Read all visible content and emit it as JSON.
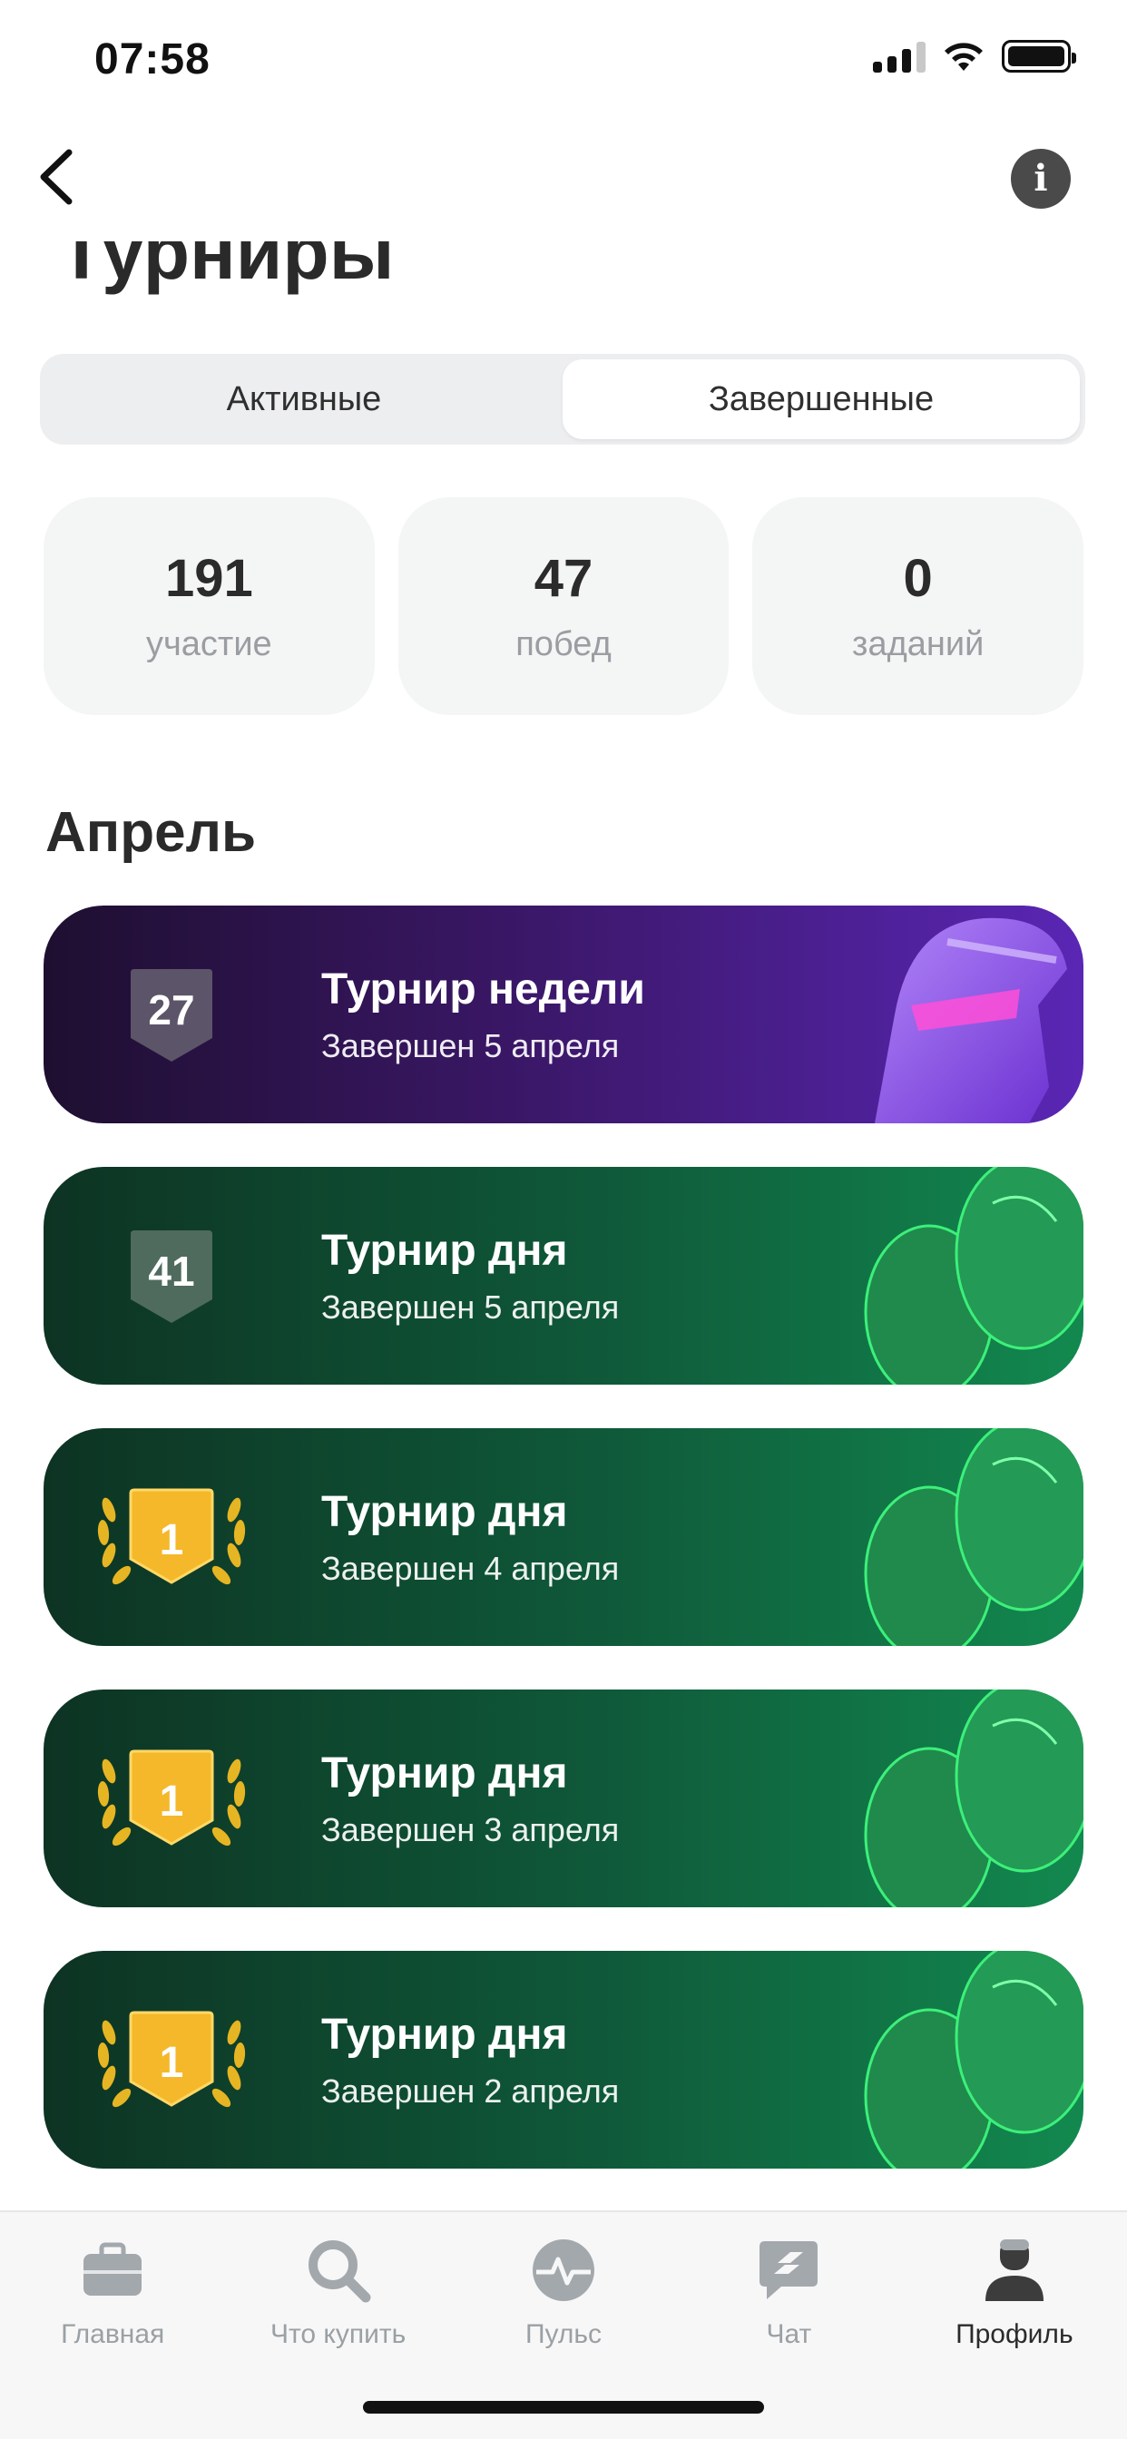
{
  "status_bar": {
    "time": "07:58"
  },
  "header": {
    "title": "Турниры"
  },
  "segmented": {
    "tabs": [
      {
        "label": "Активные"
      },
      {
        "label": "Завершенные"
      }
    ],
    "selected": "Завершенные"
  },
  "stats": [
    {
      "value": "191",
      "label": "участие"
    },
    {
      "value": "47",
      "label": "побед"
    },
    {
      "value": "0",
      "label": "заданий"
    }
  ],
  "section": {
    "title": "Апрель"
  },
  "tournaments": [
    {
      "type": "week",
      "rank": "27",
      "title": "Турнир недели",
      "subtitle": "Завершен 5 апреля"
    },
    {
      "type": "day",
      "rank": "41",
      "title": "Турнир дня",
      "subtitle": "Завершен 5 апреля"
    },
    {
      "type": "day",
      "rank": "1",
      "title": "Турнир дня",
      "subtitle": "Завершен 4 апреля"
    },
    {
      "type": "day",
      "rank": "1",
      "title": "Турнир дня",
      "subtitle": "Завершен 3 апреля"
    },
    {
      "type": "day",
      "rank": "1",
      "title": "Турнир дня",
      "subtitle": "Завершен 2 апреля"
    }
  ],
  "tab_bar": {
    "items": [
      {
        "label": "Главная",
        "icon": "briefcase-icon"
      },
      {
        "label": "Что купить",
        "icon": "search-icon"
      },
      {
        "label": "Пульс",
        "icon": "pulse-icon"
      },
      {
        "label": "Чат",
        "icon": "chat-icon"
      },
      {
        "label": "Профиль",
        "icon": "profile-icon"
      }
    ],
    "active": "Профиль"
  },
  "colors": {
    "week_card": "#3a1766",
    "day_card": "#0f5a3a",
    "gold_badge": "#f5b82a",
    "tab_inactive": "#9aa0a4"
  }
}
